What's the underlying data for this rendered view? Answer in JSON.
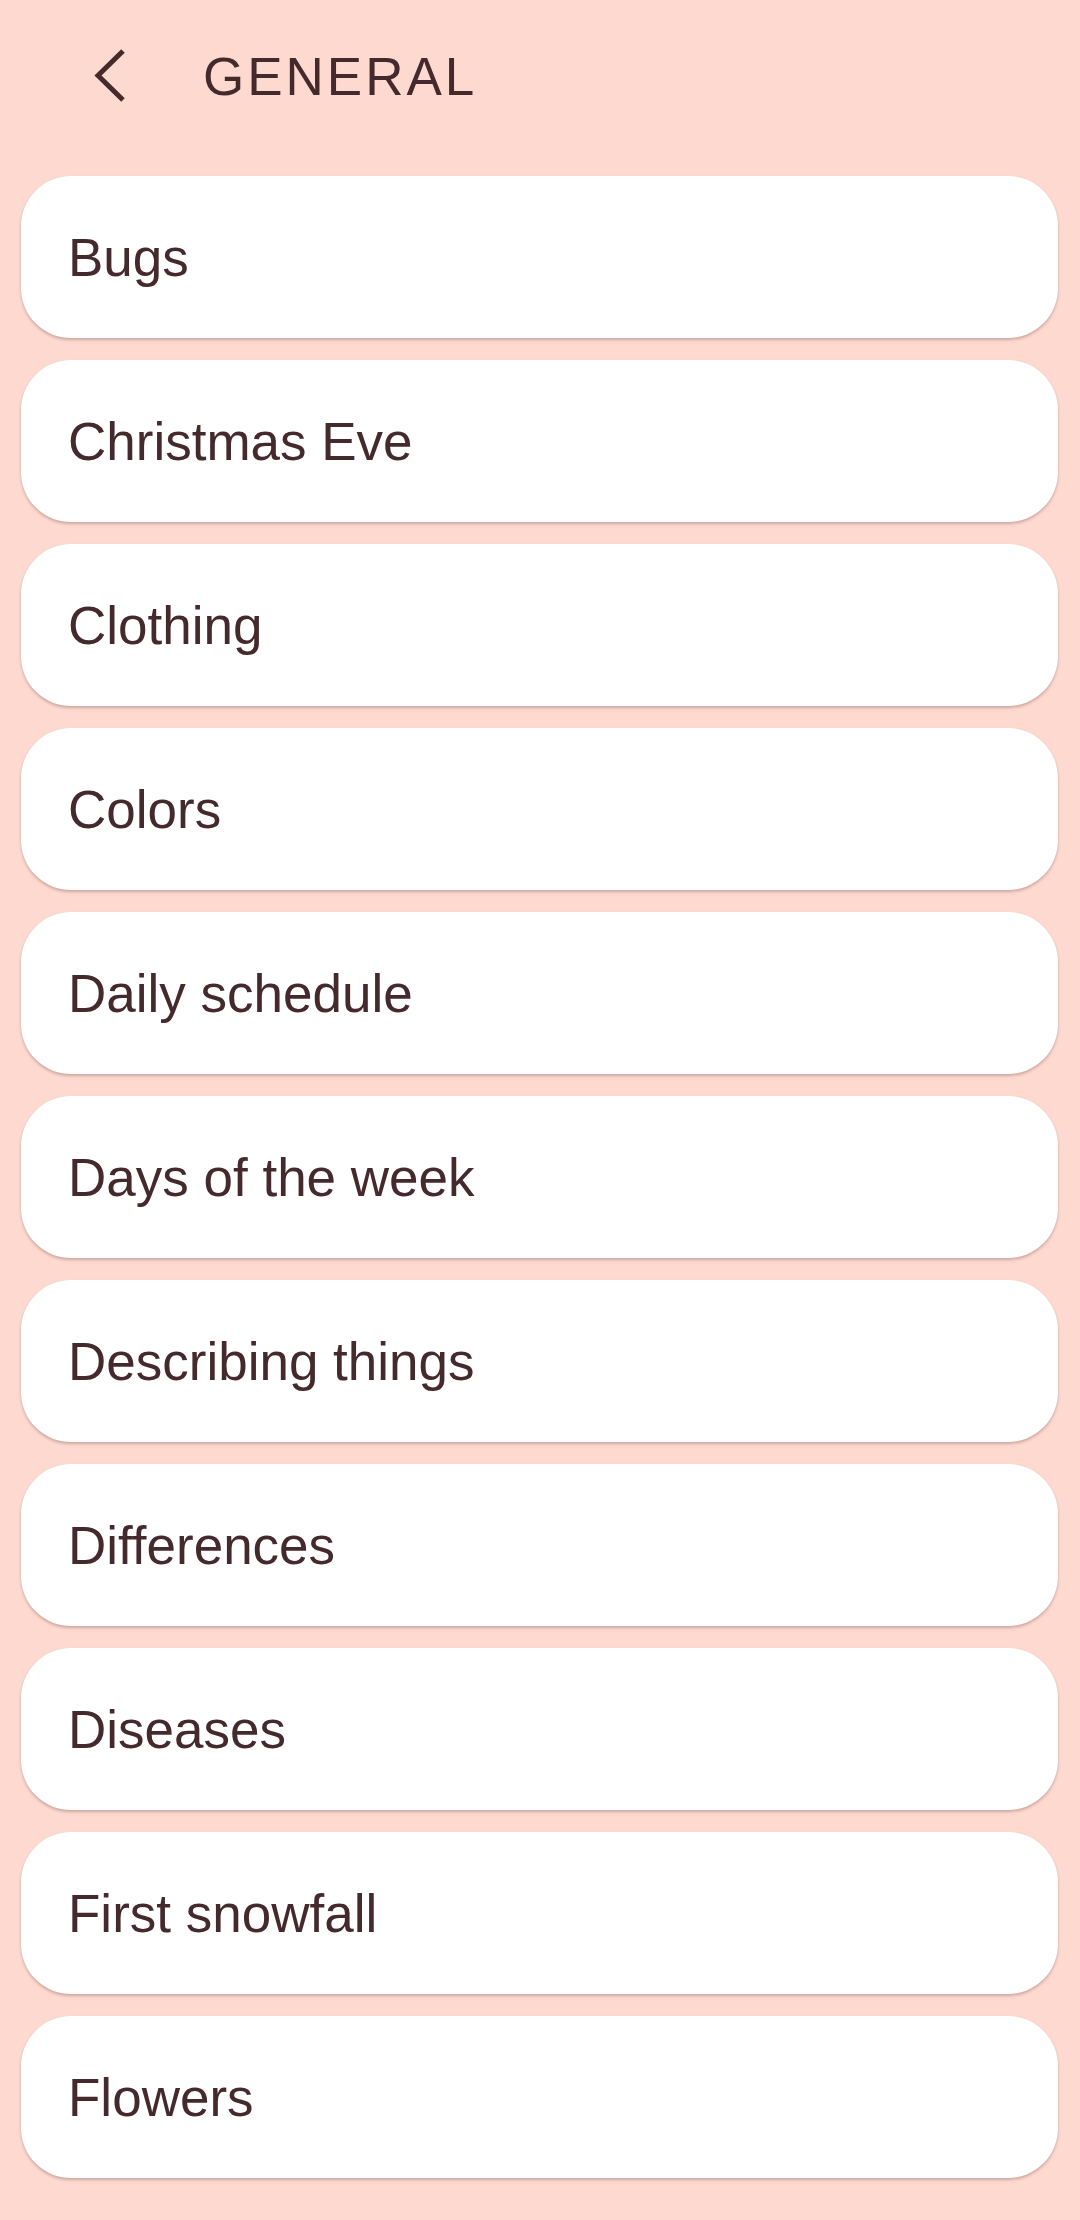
{
  "header": {
    "title": "GENERAL"
  },
  "items": [
    {
      "label": "Bugs"
    },
    {
      "label": "Christmas Eve"
    },
    {
      "label": "Clothing"
    },
    {
      "label": "Colors"
    },
    {
      "label": "Daily schedule"
    },
    {
      "label": "Days of the week"
    },
    {
      "label": "Describing things"
    },
    {
      "label": "Differences"
    },
    {
      "label": "Diseases"
    },
    {
      "label": "First snowfall"
    },
    {
      "label": "Flowers"
    }
  ]
}
